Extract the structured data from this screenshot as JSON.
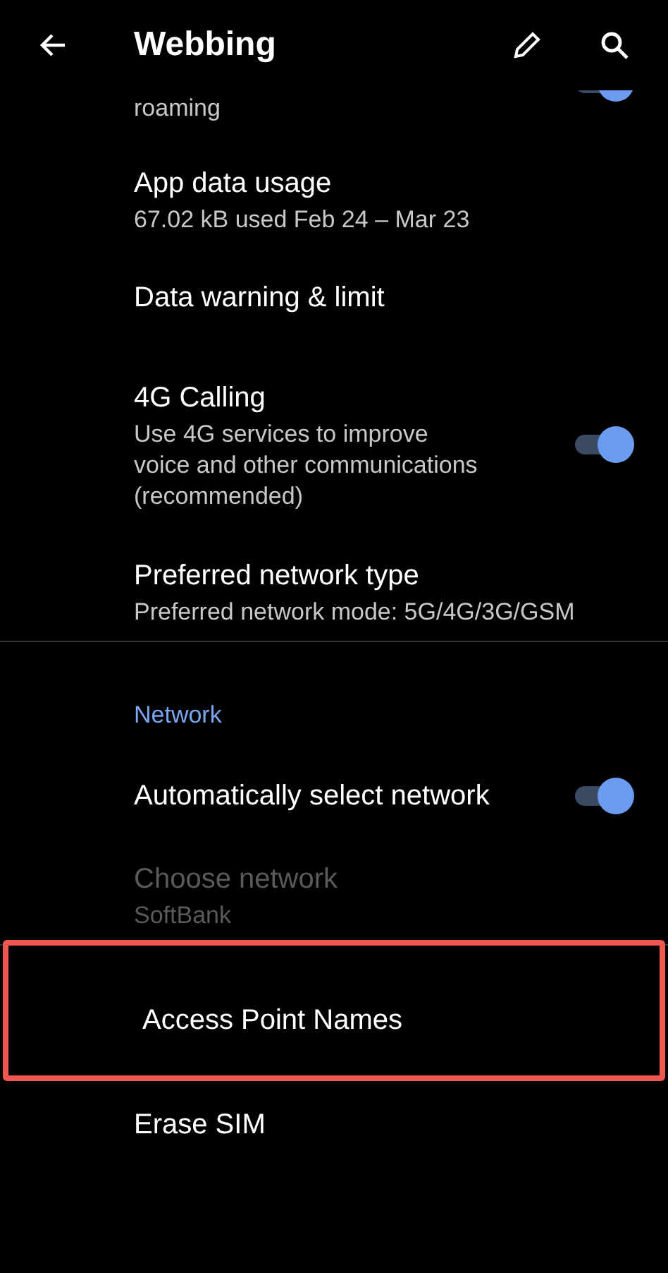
{
  "app_bar": {
    "title": "Webbing"
  },
  "items": [
    {
      "kind": "partial",
      "summary": [
        "roaming"
      ],
      "on": true
    },
    {
      "kind": "item",
      "title": "App data usage",
      "summary": [
        "67.02 kB used Feb 24 – Mar 23"
      ]
    },
    {
      "kind": "item",
      "title": "Data warning & limit"
    },
    {
      "kind": "switch",
      "title": "4G Calling",
      "summary": [
        "Use 4G services to improve",
        "voice and other communications",
        "(recommended)"
      ],
      "on": true
    },
    {
      "kind": "item",
      "title": "Preferred network type",
      "summary": [
        "Preferred network mode: 5G/4G/3G/GSM"
      ]
    },
    {
      "kind": "divider"
    },
    {
      "kind": "header",
      "title": "Network"
    },
    {
      "kind": "switch",
      "title": "Automatically select network",
      "on": true
    },
    {
      "kind": "item",
      "title": "Choose network",
      "summary": [
        "SoftBank"
      ],
      "disabled": true
    },
    {
      "kind": "divider"
    },
    {
      "kind": "item",
      "title": "Access Point Names",
      "highlighted": true
    },
    {
      "kind": "item",
      "title": "Erase SIM"
    }
  ]
}
